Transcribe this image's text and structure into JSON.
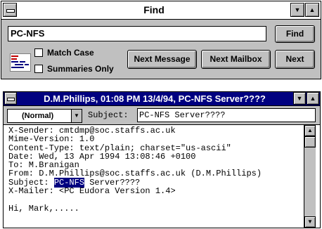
{
  "find_window": {
    "title": "Find",
    "search_value": "PC-NFS",
    "find_label": "Find",
    "match_case_label": "Match Case",
    "summaries_only_label": "Summaries Only",
    "next_message_label": "Next Message",
    "next_mailbox_label": "Next Mailbox",
    "next_label": "Next"
  },
  "message_window": {
    "title": "D.M.Phillips, 01:08 PM 13/4/94, PC-NFS Server????",
    "priority": "(Normal)",
    "subject_label": "Subject:",
    "subject_value": "PC-NFS Server????",
    "body_lines": [
      "X-Sender: cmtdmp@soc.staffs.ac.uk",
      "Mime-Version: 1.0",
      "Content-Type: text/plain; charset=\"us-ascii\"",
      "Date: Wed, 13 Apr 1994 13:08:46 +0100",
      "To: M.Branigan",
      "From: D.M.Phillips@soc.staffs.ac.uk (D.M.Phillips)"
    ],
    "subject_line_prefix": "Subject: ",
    "subject_line_highlight": "PC-NFS",
    "subject_line_suffix": " Server????",
    "body_lines_after": [
      "X-Mailer: <PC Eudora Version 1.4>",
      "",
      "Hi, Mark,....."
    ]
  },
  "icons": {
    "system_menu": "system-menu-icon",
    "minimize": "minimize-arrow-icon",
    "maximize": "maximize-arrow-icon",
    "dropdown": "dropdown-arrow-icon",
    "find_graphic": "mailbox-search-icon"
  },
  "colors": {
    "active_title": "#000080",
    "selection": "#000080",
    "face": "#c0c0c0"
  }
}
